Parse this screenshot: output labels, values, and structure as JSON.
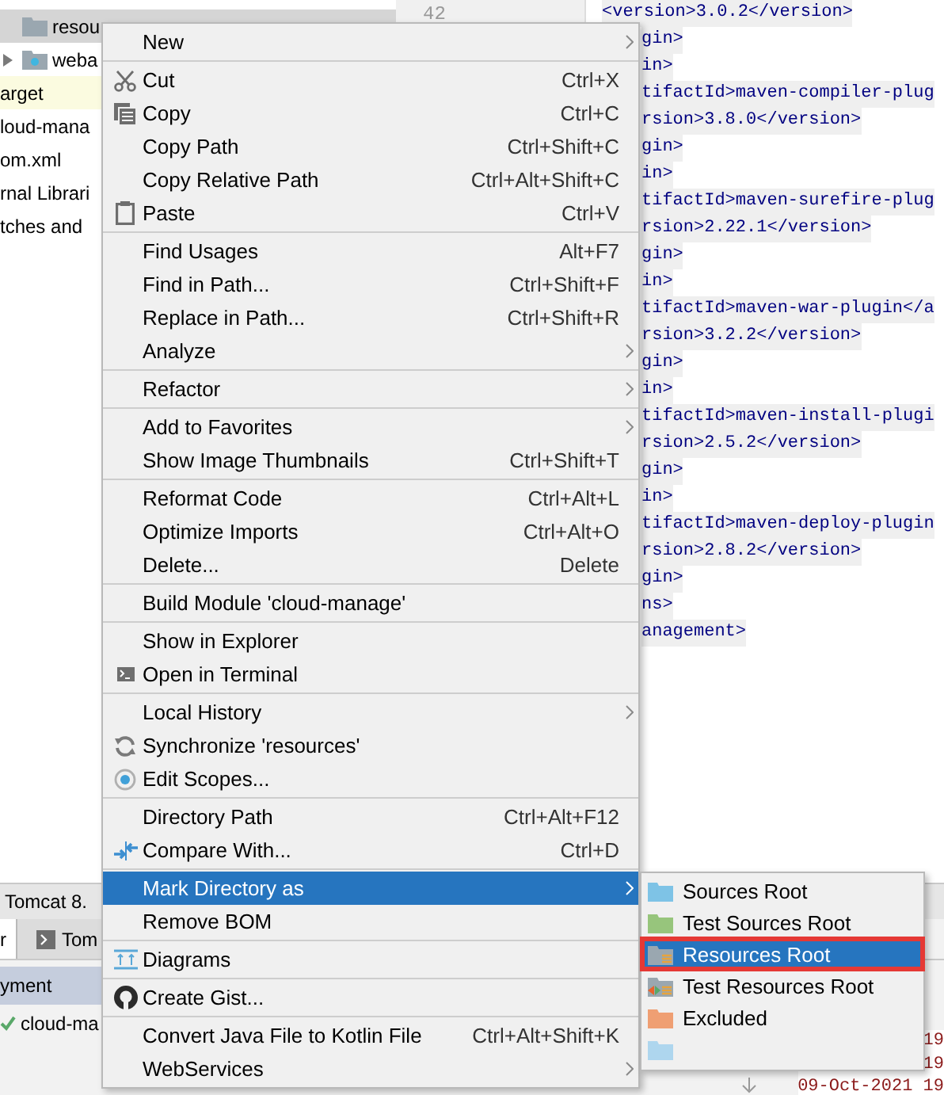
{
  "project_tree": [
    {
      "label": "resou",
      "kind": "folder",
      "expander": false,
      "selected": true,
      "highlighted": false
    },
    {
      "label": "weba",
      "kind": "web-folder",
      "expander": true,
      "selected": false,
      "highlighted": false
    },
    {
      "label": "arget",
      "kind": "plain",
      "expander": false,
      "selected": false,
      "highlighted": true
    },
    {
      "label": "loud-mana",
      "kind": "plain",
      "expander": false,
      "selected": false,
      "highlighted": false
    },
    {
      "label": "om.xml",
      "kind": "plain",
      "expander": false,
      "selected": false,
      "highlighted": false
    },
    {
      "label": "rnal Librari",
      "kind": "plain",
      "expander": false,
      "selected": false,
      "highlighted": false
    },
    {
      "label": "tches and",
      "kind": "plain",
      "expander": false,
      "selected": false,
      "highlighted": false
    }
  ],
  "editor": {
    "line_number": "42",
    "lines": [
      {
        "text": "<version>3.0.2</version>",
        "clipped": false
      },
      {
        "text": "gin>",
        "clipped": true
      },
      {
        "text": "in>",
        "clipped": true
      },
      {
        "text": "tifactId>maven-compiler-plug",
        "clipped": true
      },
      {
        "text": "rsion>3.8.0</version>",
        "clipped": true
      },
      {
        "text": "gin>",
        "clipped": true
      },
      {
        "text": "in>",
        "clipped": true
      },
      {
        "text": "tifactId>maven-surefire-plug",
        "clipped": true
      },
      {
        "text": "rsion>2.22.1</version>",
        "clipped": true
      },
      {
        "text": "gin>",
        "clipped": true
      },
      {
        "text": "in>",
        "clipped": true
      },
      {
        "text": "tifactId>maven-war-plugin</a",
        "clipped": true
      },
      {
        "text": "rsion>3.2.2</version>",
        "clipped": true
      },
      {
        "text": "gin>",
        "clipped": true
      },
      {
        "text": "in>",
        "clipped": true
      },
      {
        "text": "tifactId>maven-install-plugi",
        "clipped": true
      },
      {
        "text": "rsion>2.5.2</version>",
        "clipped": true
      },
      {
        "text": "gin>",
        "clipped": true
      },
      {
        "text": "in>",
        "clipped": true
      },
      {
        "text": "tifactId>maven-deploy-plugin",
        "clipped": true
      },
      {
        "text": "rsion>2.8.2</version>",
        "clipped": true
      },
      {
        "text": "gin>",
        "clipped": true
      },
      {
        "text": "ns>",
        "clipped": true
      },
      {
        "text": "anagement>",
        "clipped": true
      }
    ]
  },
  "run_panel": {
    "title": "Tomcat 8.",
    "tabs": [
      {
        "label": "r",
        "has_icon": false,
        "selected": true
      },
      {
        "label": "Tom",
        "has_icon": true,
        "selected": false
      }
    ],
    "column_1": "yment",
    "rows": [
      {
        "label": "cloud-ma",
        "ok": true
      }
    ],
    "log_entries": [
      "19",
      "19",
      "09-Oct-2021 19"
    ]
  },
  "context_menu": {
    "groups": [
      [
        {
          "label": "New",
          "submenu": true,
          "selected": false
        }
      ],
      [
        {
          "label": "Cut",
          "kind": "scissors",
          "shortcut": "Ctrl+X",
          "submenu": false,
          "selected": false
        },
        {
          "label": "Copy",
          "kind": "copy",
          "shortcut": "Ctrl+C",
          "submenu": false,
          "selected": false
        },
        {
          "label": "Copy Path",
          "shortcut": "Ctrl+Shift+C",
          "submenu": false,
          "selected": false
        },
        {
          "label": "Copy Relative Path",
          "shortcut": "Ctrl+Alt+Shift+C",
          "submenu": false,
          "selected": false
        },
        {
          "label": "Paste",
          "kind": "paste",
          "shortcut": "Ctrl+V",
          "submenu": false,
          "selected": false
        }
      ],
      [
        {
          "label": "Find Usages",
          "shortcut": "Alt+F7",
          "submenu": false,
          "selected": false
        },
        {
          "label": "Find in Path...",
          "shortcut": "Ctrl+Shift+F",
          "submenu": false,
          "selected": false
        },
        {
          "label": "Replace in Path...",
          "shortcut": "Ctrl+Shift+R",
          "submenu": false,
          "selected": false
        },
        {
          "label": "Analyze",
          "submenu": true,
          "selected": false
        }
      ],
      [
        {
          "label": "Refactor",
          "submenu": true,
          "selected": false
        }
      ],
      [
        {
          "label": "Add to Favorites",
          "submenu": true,
          "selected": false
        },
        {
          "label": "Show Image Thumbnails",
          "shortcut": "Ctrl+Shift+T",
          "submenu": false,
          "selected": false
        }
      ],
      [
        {
          "label": "Reformat Code",
          "shortcut": "Ctrl+Alt+L",
          "submenu": false,
          "selected": false
        },
        {
          "label": "Optimize Imports",
          "shortcut": "Ctrl+Alt+O",
          "submenu": false,
          "selected": false
        },
        {
          "label": "Delete...",
          "shortcut": "Delete",
          "submenu": false,
          "selected": false
        }
      ],
      [
        {
          "label": "Build Module 'cloud-manage'",
          "submenu": false,
          "selected": false
        }
      ],
      [
        {
          "label": "Show in Explorer",
          "submenu": false,
          "selected": false
        },
        {
          "label": "Open in Terminal",
          "kind": "terminal",
          "submenu": false,
          "selected": false
        }
      ],
      [
        {
          "label": "Local History",
          "submenu": true,
          "selected": false
        },
        {
          "label": "Synchronize 'resources'",
          "kind": "sync",
          "submenu": false,
          "selected": false
        },
        {
          "label": "Edit Scopes...",
          "kind": "scope",
          "submenu": false,
          "selected": false
        }
      ],
      [
        {
          "label": "Directory Path",
          "shortcut": "Ctrl+Alt+F12",
          "submenu": false,
          "selected": false
        },
        {
          "label": "Compare With...",
          "kind": "compare",
          "shortcut": "Ctrl+D",
          "submenu": false,
          "selected": false
        }
      ],
      [
        {
          "label": "Mark Directory as",
          "submenu": true,
          "selected": true
        },
        {
          "label": "Remove BOM",
          "submenu": false,
          "selected": false
        }
      ],
      [
        {
          "label": "Diagrams",
          "kind": "diagram",
          "submenu": false,
          "selected": false
        }
      ],
      [
        {
          "label": "Create Gist...",
          "kind": "gist",
          "submenu": false,
          "selected": false
        }
      ],
      [
        {
          "label": "Convert Java File to Kotlin File",
          "shortcut": "Ctrl+Alt+Shift+K",
          "submenu": false,
          "selected": false
        },
        {
          "label": "WebServices",
          "submenu": true,
          "selected": false
        }
      ]
    ]
  },
  "submenu": {
    "items": [
      {
        "label": "Sources Root",
        "kind": "source",
        "selected": false,
        "outlined": false
      },
      {
        "label": "Test Sources Root",
        "kind": "test-source",
        "selected": false,
        "outlined": false
      },
      {
        "label": "Resources Root",
        "kind": "resource",
        "selected": true,
        "outlined": true
      },
      {
        "label": "Test Resources Root",
        "kind": "test-resource",
        "selected": false,
        "outlined": false
      },
      {
        "label": "Excluded",
        "kind": "excluded",
        "selected": false,
        "outlined": false
      },
      {
        "kind": "faded",
        "selected": false,
        "outlined": false
      }
    ]
  }
}
